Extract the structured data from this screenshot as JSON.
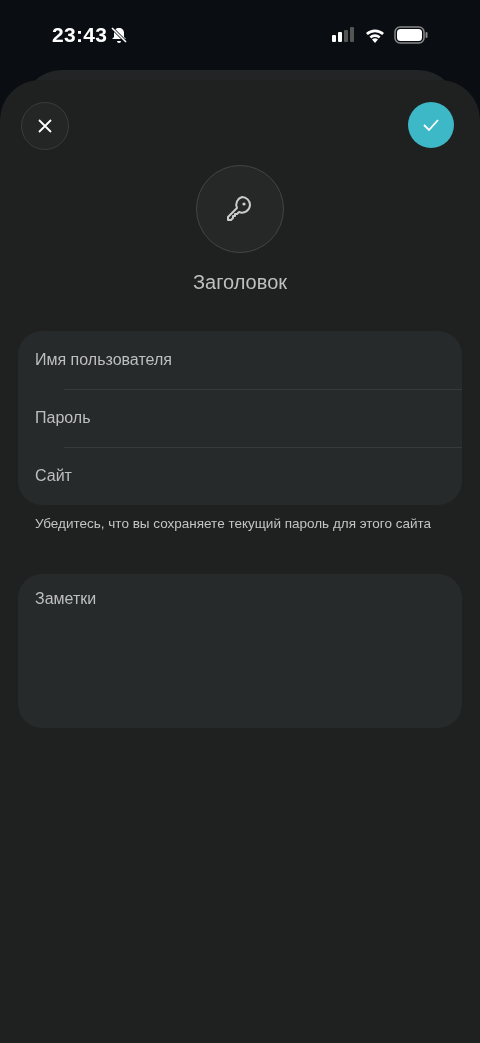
{
  "status_bar": {
    "time": "23:43"
  },
  "header": {
    "title_placeholder": "Заголовок"
  },
  "fields": [
    {
      "placeholder": "Имя пользователя"
    },
    {
      "placeholder": "Пароль"
    },
    {
      "placeholder": "Сайт"
    }
  ],
  "hint": "Убедитесь, что вы сохраняете текущий пароль для этого сайта",
  "notes": {
    "placeholder": "Заметки"
  }
}
